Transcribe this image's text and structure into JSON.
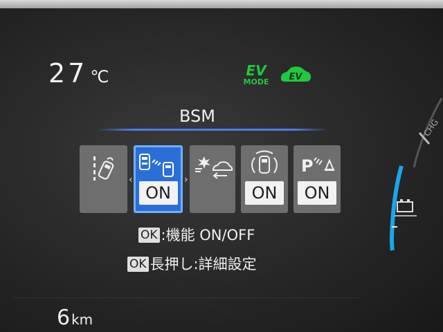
{
  "status_bar": {
    "temperature_value": "27",
    "temperature_unit": "℃",
    "ev_mode_ev": "EV",
    "ev_mode_mode": "MODE",
    "ev_badge": "EV"
  },
  "menu": {
    "title": "BSM",
    "tiles": [
      {
        "icon": "lane-departure-icon",
        "status": "",
        "selected": false
      },
      {
        "icon": "blind-spot-monitor-icon",
        "status": "ON",
        "selected": true
      },
      {
        "icon": "pre-collision-icon",
        "status": "",
        "selected": false
      },
      {
        "icon": "parking-support-icon",
        "status": "ON",
        "selected": false
      },
      {
        "icon": "parking-sensor-icon",
        "status": "ON",
        "selected": false
      }
    ]
  },
  "hints": {
    "ok_label": "OK",
    "toggle_text": ":機能 ON/OFF",
    "long_press_text": "長押し:詳細設定"
  },
  "trip": {
    "distance_value": "6",
    "distance_unit": "km"
  },
  "gauge": {
    "label": "CHG"
  },
  "colors": {
    "ev_green": "#20c840",
    "selection_blue": "#2a6fd8",
    "gauge_cyan": "#1aa6e8"
  }
}
